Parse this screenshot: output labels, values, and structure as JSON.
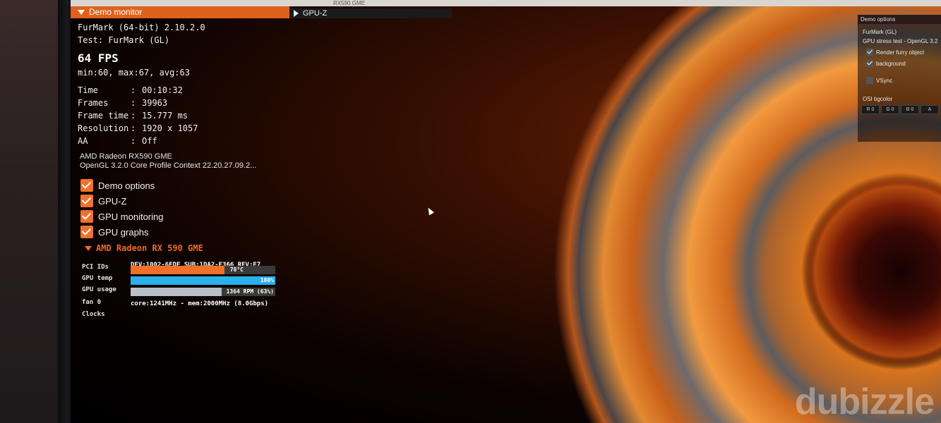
{
  "demo_monitor": {
    "title": "Demo monitor",
    "app_name": "FurMark (64-bit) 2.10.2.0",
    "test": "Test: FurMark (GL)",
    "fps": "64 FPS",
    "fps_stats": "min:60, max:67, avg:63",
    "stats": [
      {
        "key": "Time",
        "value": "00:10:32"
      },
      {
        "key": "Frames",
        "value": "39963"
      },
      {
        "key": "Frame time",
        "value": "15.777 ms"
      },
      {
        "key": "Resolution",
        "value": "1920 x 1057"
      },
      {
        "key": "AA",
        "value": "Off"
      }
    ],
    "gpu_name": "AMD Radeon RX590 GME",
    "gl_context": "OpenGL 3.2.0 Core Profile Context 22.20.27.09.2...",
    "checkboxes": [
      {
        "label": "Demo options",
        "checked": true
      },
      {
        "label": "GPU-Z",
        "checked": true
      },
      {
        "label": "GPU monitoring",
        "checked": true
      },
      {
        "label": "GPU graphs",
        "checked": true
      }
    ],
    "gpu_section": {
      "header": "AMD Radeon RX 590 GME",
      "pci_label": "PCI IDs",
      "pci_value": "DEV:1002-6FDF SUB:1DA2-E366 REV:E7",
      "temp_label": "GPU temp",
      "temp_value": "78°C",
      "temp_fraction": 0.65,
      "temp_color": "#f0702a",
      "usage_label": "GPU usage",
      "usage_value": "100%",
      "usage_fraction": 1.0,
      "usage_color": "#2ab0ea",
      "fan_label": "fan 0",
      "fan_value": "1364 RPM (63%)",
      "fan_fraction": 0.63,
      "fan_color": "#b9c0c8",
      "clocks_label": "Clocks",
      "clocks_value": "core:1241MHz - mem:2000MHz (8.0Gbps)"
    }
  },
  "gpuz": {
    "title": "GPU-Z"
  },
  "top_strip": {
    "text": "RX590 GME"
  },
  "demo_options": {
    "title": "Demo options",
    "line1": "FurMark (GL)",
    "line2": "GPU stress test - OpenGL 3.2",
    "options": [
      {
        "label": "Render furry object",
        "checked": true
      },
      {
        "label": "background",
        "checked": true
      },
      {
        "label": "VSync",
        "checked": false
      }
    ],
    "osi_label": "OSI bgcolor",
    "rgba": [
      "R 0",
      "G 0",
      "B 0",
      "A"
    ]
  },
  "watermark": "dubizzle"
}
